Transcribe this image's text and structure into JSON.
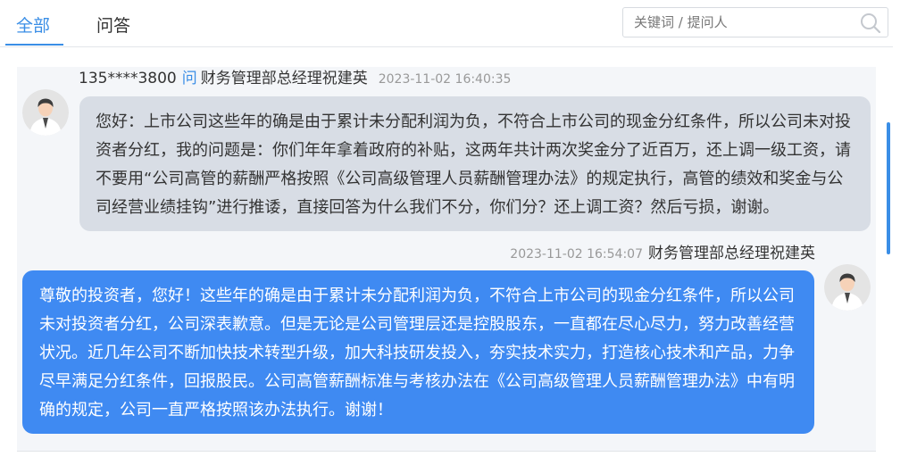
{
  "tabs": [
    {
      "label": "全部",
      "active": true
    },
    {
      "label": "问答",
      "active": false
    }
  ],
  "search": {
    "placeholder": "关键词 / 提问人",
    "icon": "search-icon"
  },
  "question": {
    "user": "135****3800",
    "ask_marker": "问",
    "target": "财务管理部总经理祝建英",
    "time": "2023-11-02 16:40:35",
    "text": "您好：上市公司这些年的确是由于累计未分配利润为负，不符合上市公司的现金分红条件，所以公司未对投资者分红，我的问题是：你们年年拿着政府的补贴，这两年共计两次奖金分了近百万，还上调一级工资，请不要用“公司高管的薪酬严格按照《公司高级管理人员薪酬管理办法》的规定执行，高管的绩效和奖金与公司经营业绩挂钩”进行推诿，直接回答为什么我们不分，你们分？还上调工资？然后亏损，谢谢。"
  },
  "answer": {
    "time": "2023-11-02 16:54:07",
    "responder": "财务管理部总经理祝建英",
    "text": "尊敬的投资者，您好！这些年的确是由于累计未分配利润为负，不符合上市公司的现金分红条件，所以公司未对投资者分红，公司深表歉意。但是无论是公司管理层还是控股股东，一直都在尽心尽力，努力改善经营状况。近几年公司不断加快技术转型升级，加大科技研发投入，夯实技术实力，打造核心技术和产品，力争尽早满足分红条件，回报股民。公司高管薪酬标准与考核办法在《公司高级管理人员薪酬管理办法》中有明确的规定，公司一直严格按照该办法执行。谢谢！"
  },
  "colors": {
    "accent": "#3a8ee6",
    "question_bubble": "#d8dde5",
    "answer_bubble": "#3f8af2"
  }
}
